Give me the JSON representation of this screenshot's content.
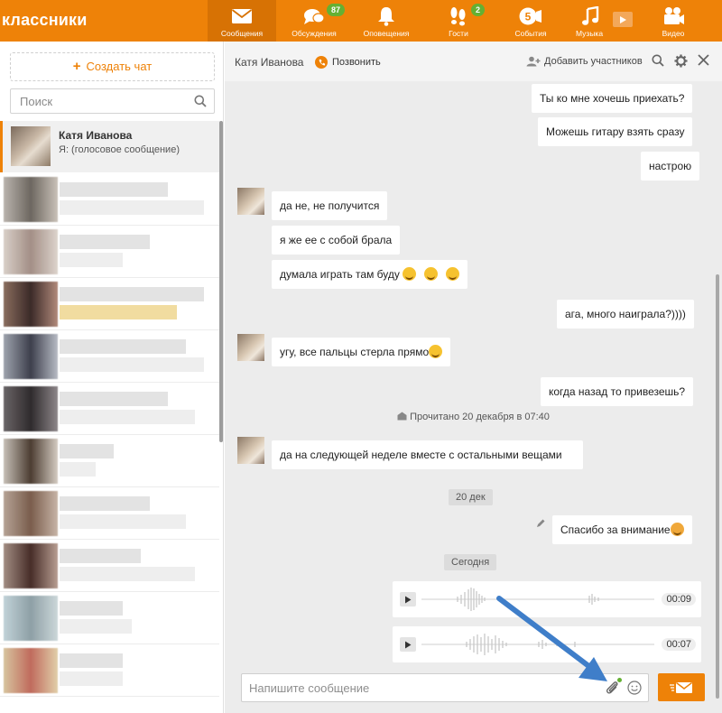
{
  "app": {
    "brand": "классники"
  },
  "nav": [
    {
      "id": "messages",
      "label": "Сообщения",
      "icon": "envelope-icon",
      "badge": "",
      "active": true
    },
    {
      "id": "discussions",
      "label": "Обсуждения",
      "icon": "discussions-icon",
      "badge": "87",
      "active": false
    },
    {
      "id": "notifications",
      "label": "Оповещения",
      "icon": "bell-icon",
      "badge": "",
      "active": false
    },
    {
      "id": "guests",
      "label": "Гости",
      "icon": "footprints-icon",
      "badge": "2",
      "active": false
    },
    {
      "id": "events",
      "label": "События",
      "icon": "events-icon",
      "badge": "",
      "active": false
    },
    {
      "id": "music",
      "label": "Музыка",
      "icon": "music-note-icon",
      "badge": "",
      "active": false
    },
    {
      "id": "video",
      "label": "Видео",
      "icon": "video-camera-icon",
      "badge": "",
      "active": false
    }
  ],
  "sidebar": {
    "create_chat": "Создать чат",
    "search_placeholder": "Поиск",
    "active_chat": {
      "name": "Катя Иванова",
      "preview": "Я:  (голосовое сообщение)"
    }
  },
  "chat": {
    "contact_name": "Катя Иванова",
    "call_label": "Позвонить",
    "add_members_label": "Добавить участников",
    "messages": [
      {
        "from": "me",
        "text": "Ты ко мне хочешь приехать?"
      },
      {
        "from": "me",
        "text": "Можешь гитару взять сразу"
      },
      {
        "from": "me",
        "text": "настрою"
      },
      {
        "from": "them",
        "text": "да не, не получится"
      },
      {
        "from": "them",
        "text": "я же ее с собой брала"
      },
      {
        "from": "them",
        "text": "думала играть там буду"
      },
      {
        "from": "me",
        "text": "ага, много наиграла?))))"
      },
      {
        "from": "them",
        "text": "угу, все пальцы стерла прямо"
      },
      {
        "from": "me",
        "text": "когда назад то привезешь?"
      },
      {
        "from": "them",
        "text": "да на следующей неделе вместе с остальными вещами"
      },
      {
        "from": "me",
        "text": "Спасибо за внимание"
      }
    ],
    "read_status": "Прочитано 20 декабря в 07:40",
    "date_dec20": "20 дек",
    "date_today": "Сегодня",
    "voice_messages": [
      {
        "duration": "00:09"
      },
      {
        "duration": "00:07"
      }
    ],
    "composer_placeholder": "Напишите сообщение"
  },
  "colors": {
    "accent": "#ee8208",
    "badge": "#64b033",
    "chat_bg": "#ececec",
    "arrow": "#3f7ec9"
  }
}
